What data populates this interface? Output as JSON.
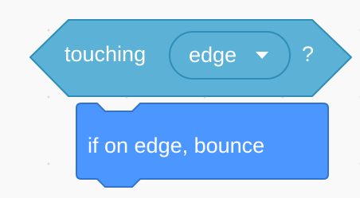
{
  "touching_block": {
    "label": "touching",
    "menu_value": "edge",
    "suffix": "?",
    "color": "#5cb1d6",
    "border_color": "#2e8eb8"
  },
  "bounce_block": {
    "label": "if on edge, bounce",
    "color": "#4c97ff",
    "border_color": "#3373cc"
  },
  "icons": {
    "dropdown": "chevron-down-icon"
  }
}
